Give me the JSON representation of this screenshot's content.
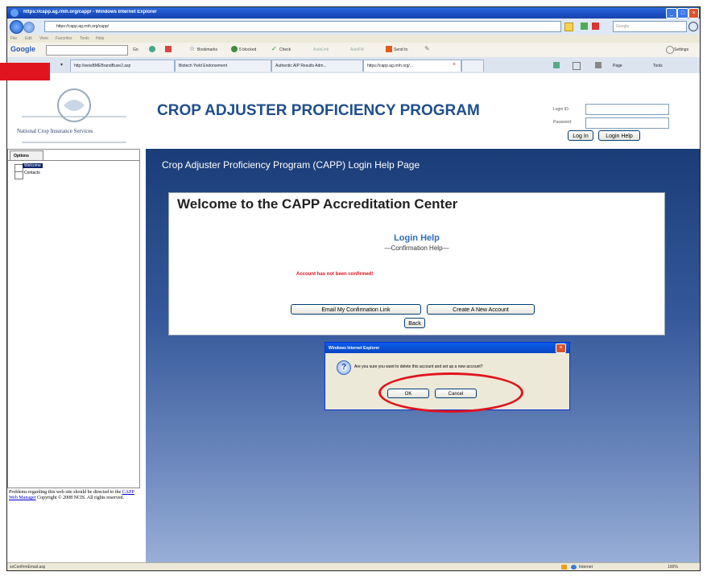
{
  "browser": {
    "title": "https://capp.ag.rmh.org/capp/ - Windows Internet Explorer",
    "address": "https://capp.ag.rmh.org/capp/",
    "search_placeholder": "Google",
    "menu": [
      "File",
      "Edit",
      "View",
      "Favorites",
      "Tools",
      "Help"
    ],
    "google_toolbar": {
      "logo": "Google",
      "go": "Go",
      "bookmarks": "Bookmarks",
      "blocked": "5 blocked",
      "check": "Check",
      "autolink": "AutoLink",
      "autofill": "AutoFill",
      "sendto": "Send to",
      "settings": "Settings"
    },
    "tabs": [
      "http://weisBMEBrandBuse2.asp",
      "Biotech Yield Endorsement",
      "Authentic AIP Results Adm...",
      "https://capp.ag.rmh.org/..."
    ],
    "tab_tools": {
      "page": "Page",
      "tools": "Tools"
    },
    "status": "ssConfirmEmail.asp",
    "zone": "Internet",
    "zoom": "100%"
  },
  "header": {
    "logo_text": "National Crop Insurance Services",
    "program_title": "CROP ADJUSTER PROFICIENCY PROGRAM",
    "login_id_label": "Login ID:",
    "password_label": "Password:",
    "login_button": "Log In",
    "login_help_button": "Login Help"
  },
  "sidebar": {
    "tab_label": "Options",
    "items": [
      {
        "label": "Welcome",
        "selected": true
      },
      {
        "label": "Contacts",
        "selected": false
      }
    ],
    "footer_text": "Problems regarding this web site should be directed to the",
    "footer_link": "CAPP Web Manager",
    "footer_text2": "Copyright © 2008 NCIS. All rights reserved."
  },
  "main": {
    "page_heading": "Crop Adjuster Proficiency Program (CAPP) Login Help Page",
    "card_title": "Welcome to the CAPP Accreditation Center",
    "login_help_title": "Login Help",
    "login_help_sub": "—Confirmation Help—",
    "error": "Account has not been confirmed!",
    "email_link_button": "Email My Confirmation Link",
    "create_account_button": "Create A New Account",
    "back_button": "Back"
  },
  "dialog": {
    "title": "Windows Internet Explorer",
    "message": "Are you sure you want to delete this account and set up a new account?",
    "ok": "OK",
    "cancel": "Cancel"
  },
  "colors": {
    "title_blue": "#1f4e8c",
    "error_red": "#e0141e",
    "annotation_red": "#e0141e"
  }
}
